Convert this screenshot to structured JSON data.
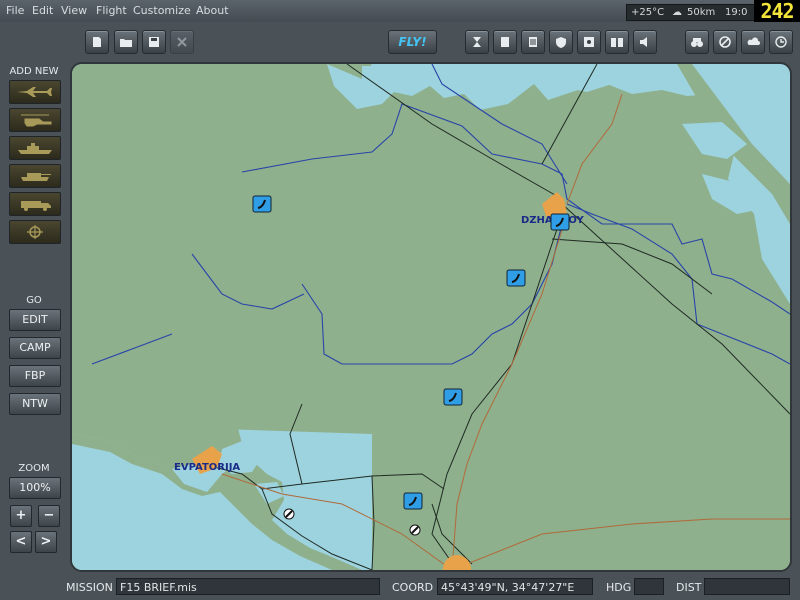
{
  "menu": {
    "items": [
      "File",
      "Edit",
      "View",
      "Flight",
      "Customize",
      "About"
    ]
  },
  "status": {
    "temperature": "+25°C",
    "cloud": "50km",
    "time_partial": "19:0",
    "clock": "242"
  },
  "toolbar": {
    "fly_label": "FLY!"
  },
  "sidebar": {
    "add_new_label": "ADD NEW",
    "go_label": "GO",
    "go_buttons": [
      "EDIT",
      "CAMP",
      "FBP",
      "NTW"
    ],
    "zoom_label": "ZOOM",
    "zoom_value": "100%",
    "zoom_in": "+",
    "zoom_out": "−",
    "prev": "<",
    "next": ">"
  },
  "map": {
    "cities": [
      "DZHANKOY",
      "EVPATORIJA"
    ]
  },
  "bottom": {
    "mission_label": "MISSION",
    "mission_value": "F15 BRIEF.mis",
    "coord_label": "COORD",
    "coord_value": "45°43'49\"N, 34°47'27\"E",
    "hdg_label": "HDG",
    "hdg_value": "",
    "dist_label": "DIST",
    "dist_value": ""
  },
  "colors": {
    "land": "#8fb08d",
    "sea": "#9dd3df",
    "city": "#e8a24a",
    "road": "#1e2a22",
    "border": "#2844a8",
    "rail": "#b06a3a",
    "airfield": "#2f9ee6"
  }
}
